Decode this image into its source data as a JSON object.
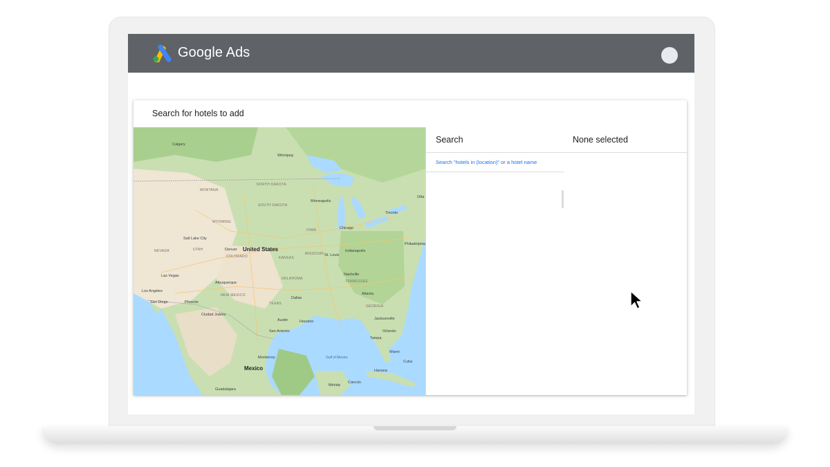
{
  "app": {
    "title": "Google Ads"
  },
  "panel": {
    "title": "Search for hotels to add",
    "search": {
      "header": "Search",
      "hint": "Search \"hotels in (location)\" or a hotel name"
    },
    "selection": {
      "header": "None selected"
    }
  },
  "map": {
    "labels": {
      "country_us": "United States",
      "country_mx": "Mexico",
      "calgary": "Calgary",
      "winnipeg": "Winnipeg",
      "minneapolis": "Minneapolis",
      "chicago": "Chicago",
      "toronto": "Toronto",
      "ottawa": "Otta",
      "montana": "MONTANA",
      "north_dakota": "NORTH DAKOTA",
      "south_dakota": "SOUTH DAKOTA",
      "wyoming": "WYOMING",
      "nevada": "NEVADA",
      "utah": "UTAH",
      "colorado": "COLORADO",
      "kansas": "KANSAS",
      "missouri": "MISSOURI",
      "iowa": "IOWA",
      "oklahoma": "OKLAHOMA",
      "new_mexico": "NEW MEXICO",
      "texas": "TEXAS",
      "tennessee": "TENNESSEE",
      "georgia": "GEORGIA",
      "salt_lake_city": "Salt Lake City",
      "denver": "Denver",
      "las_vegas": "Las Vegas",
      "los_angeles": "Los Angeles",
      "san_diego": "San Diego",
      "phoenix": "Phoenix",
      "albuquerque": "Albuquerque",
      "ciudad_juarez": "Ciudad Juárez",
      "dallas": "Dallas",
      "austin": "Austin",
      "san_antonio": "San Antonio",
      "houston": "Houston",
      "monterrey": "Monterrey",
      "st_louis": "St. Louis",
      "indianapolis": "Indianapolis",
      "nashville": "Nashville",
      "atlanta": "Atlanta",
      "jacksonville": "Jacksonville",
      "orlando": "Orlando",
      "tampa": "Tampa",
      "miami": "Miami",
      "havana": "Havana",
      "cuba": "Cuba",
      "merida": "Mérida",
      "cancun": "Cancún",
      "guadalajara": "Guadalajara",
      "philadelphia": "Philadelphia",
      "gulf_of_mexico": "Gulf of Mexico"
    }
  }
}
